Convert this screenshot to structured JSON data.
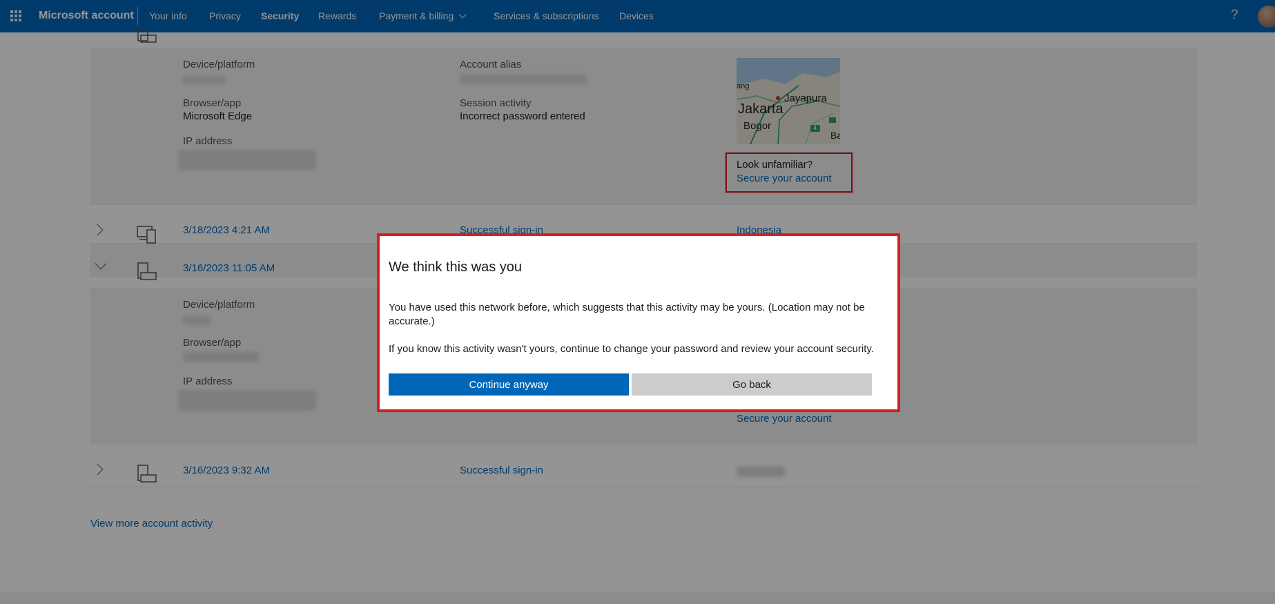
{
  "nav": {
    "brand": "Microsoft account",
    "items": [
      "Your info",
      "Privacy",
      "Security",
      "Rewards",
      "Payment & billing",
      "Services & subscriptions",
      "Devices"
    ],
    "active": "Security",
    "help_glyph": "?"
  },
  "detail_expanded_1": {
    "device_platform_label": "Device/platform",
    "browser_app_label": "Browser/app",
    "browser_app_value": "Microsoft Edge",
    "ip_address_label": "IP address",
    "account_alias_label": "Account alias",
    "session_activity_label": "Session activity",
    "session_activity_value": "Incorrect password entered",
    "map_labels": [
      "ang",
      "Jayapura",
      "Jakarta",
      "Bogor",
      "Ba",
      "4"
    ],
    "look_unfamiliar": "Look unfamiliar?",
    "secure_link": "Secure your account"
  },
  "activity_rows": [
    {
      "date": "3/18/2023 4:21 AM",
      "activity": "Successful sign-in",
      "location": "Indonesia",
      "expanded": false
    },
    {
      "date": "3/16/2023 11:05 AM",
      "expanded": true
    },
    {
      "date": "3/16/2023 9:32 AM",
      "activity": "Successful sign-in",
      "expanded": false
    }
  ],
  "detail_expanded_2": {
    "device_platform_label": "Device/platform",
    "browser_app_label": "Browser/app",
    "ip_address_label": "IP address",
    "secure_link": "Secure your account"
  },
  "view_more": "View more account activity",
  "dialog": {
    "title": "We think this was you",
    "paragraph1": "You have used this network before, which suggests that this activity may be yours. (Location may not be accurate.)",
    "paragraph2": "If you know this activity wasn't yours, continue to change your password and review your account security.",
    "continue_label": "Continue anyway",
    "back_label": "Go back"
  },
  "colors": {
    "nav_bg": "#0067b8",
    "link": "#0067b8",
    "highlight": "#d21f26",
    "secondary_button": "#cccccc"
  }
}
